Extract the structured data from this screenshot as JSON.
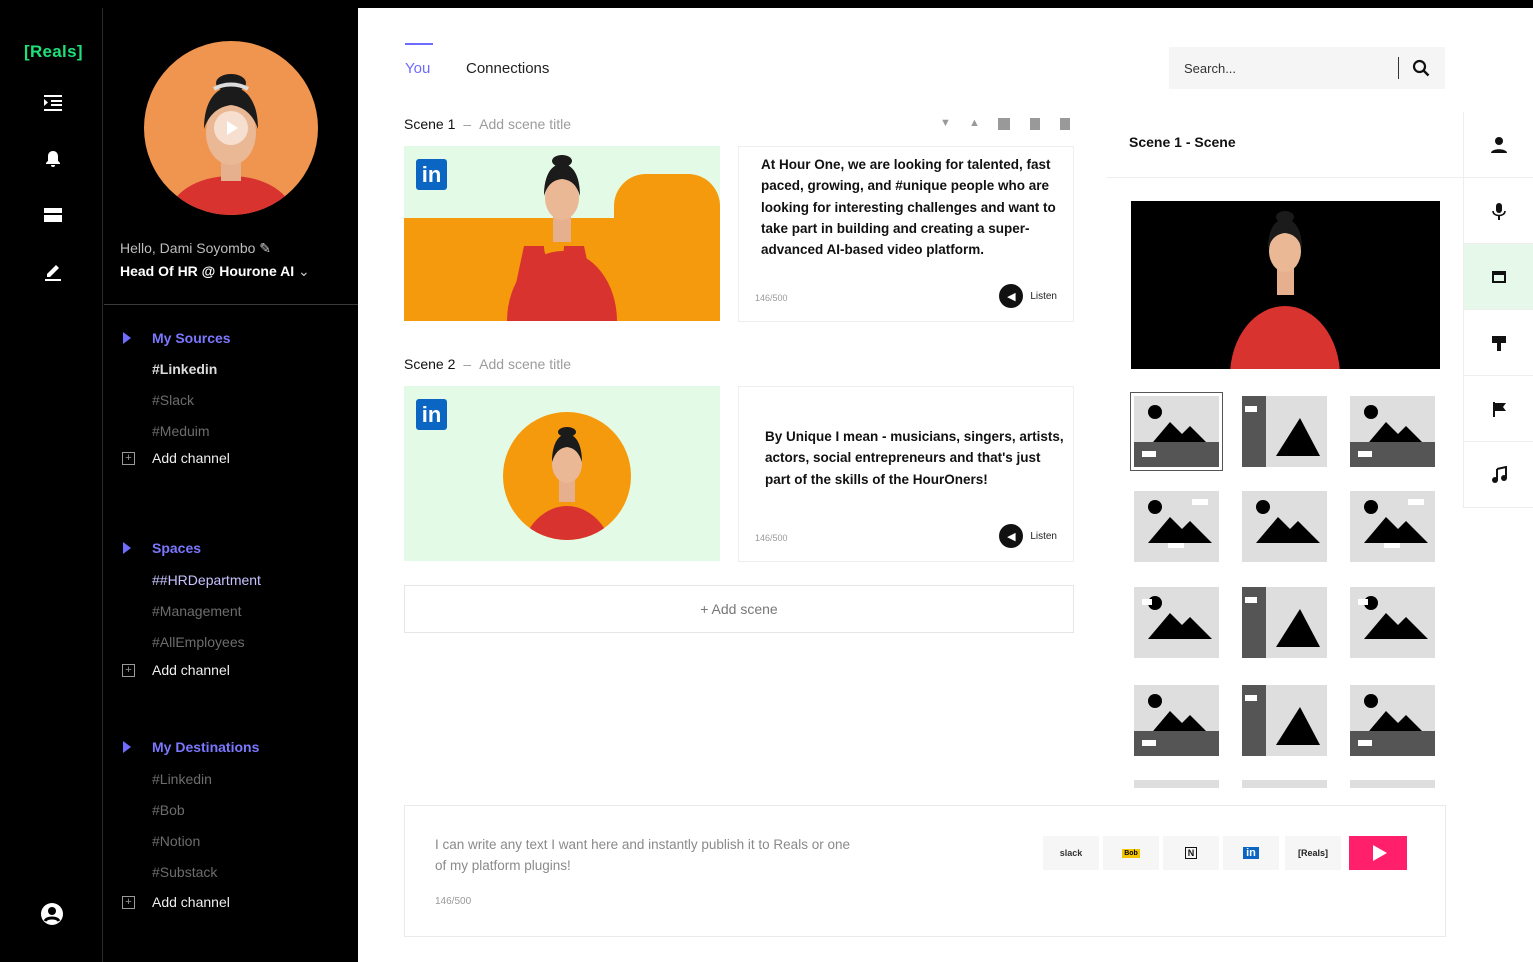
{
  "brand": {
    "logo": "[Reals]",
    "accent": "#1fe07a",
    "link_color": "#6b6cff",
    "send_color": "#ff1f6b"
  },
  "rail": {
    "icons": [
      "indent-list-icon",
      "bell-icon",
      "card-icon",
      "pen-edit-icon"
    ],
    "bottom_icon": "user-circle-icon"
  },
  "profile": {
    "greeting": "Hello, Dami Soyombo",
    "role": "Head Of HR @ Hourone AI"
  },
  "sections": [
    {
      "title": "My Sources",
      "channels": [
        "#Linkedin",
        "#Slack",
        "#Meduim"
      ],
      "add_label": "Add channel"
    },
    {
      "title": "Spaces",
      "channels": [
        "##HRDepartment",
        "#Management",
        "#AllEmployees"
      ],
      "add_label": "Add channel"
    },
    {
      "title": "My Destinations",
      "channels": [
        "#Linkedin",
        "#Bob",
        "#Notion",
        "#Substack"
      ],
      "add_label": "Add channel"
    }
  ],
  "tabs": [
    "You",
    "Connections"
  ],
  "search": {
    "placeholder": "Search..."
  },
  "scenes": [
    {
      "label": "Scene 1",
      "placeholder": "Add scene title",
      "text": "At Hour One, we are looking for talented, fast paced, growing, and #unique people who are looking for interesting challenges and want to take part in building and creating a super-advanced AI-based video platform.",
      "count": "146/500",
      "listen": "Listen"
    },
    {
      "label": "Scene 2",
      "placeholder": "Add scene title",
      "text": "By Unique I mean - musicians, singers, artists, actors, social entrepreneurs and that's just part of the skills of the HourOners!",
      "count": "146/500",
      "listen": "Listen"
    }
  ],
  "add_scene": "+ Add scene",
  "right_panel": {
    "title": "Scene 1 - Scene",
    "tools": [
      "person-icon",
      "microphone-icon",
      "frame-icon",
      "paint-roller-icon",
      "flag-icon",
      "music-note-icon"
    ]
  },
  "composer": {
    "text": "I can write any text I want here and instantly publish it to Reals or one of my platform plugins!",
    "count": "146/500",
    "plugins": [
      "slack",
      "Bob",
      "N",
      "in",
      "[Reals]"
    ]
  }
}
